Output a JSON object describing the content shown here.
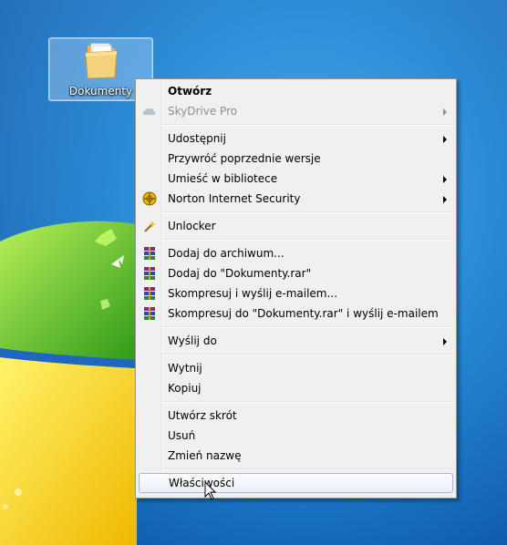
{
  "desktop": {
    "icon": {
      "label": "Dokumenty",
      "icon": "folder-icon"
    }
  },
  "context_menu": {
    "groups": [
      [
        {
          "label": "Otwórz",
          "bold": true
        },
        {
          "label": "SkyDrive Pro",
          "disabled": true,
          "submenu": true,
          "icon": "skydrive-cloud-icon"
        }
      ],
      [
        {
          "label": "Udostępnij",
          "submenu": true
        },
        {
          "label": "Przywróć poprzednie wersje"
        },
        {
          "label": "Umieść w bibliotece",
          "submenu": true
        },
        {
          "label": "Norton Internet Security",
          "submenu": true,
          "icon": "norton-icon"
        }
      ],
      [
        {
          "label": "Unlocker",
          "icon": "unlocker-wand-icon"
        }
      ],
      [
        {
          "label": "Dodaj do archiwum...",
          "icon": "winrar-icon"
        },
        {
          "label": "Dodaj do \"Dokumenty.rar\"",
          "icon": "winrar-icon"
        },
        {
          "label": "Skompresuj i wyślij e-mailem...",
          "icon": "winrar-icon"
        },
        {
          "label": "Skompresuj do \"Dokumenty.rar\" i wyślij e-mailem",
          "icon": "winrar-icon"
        }
      ],
      [
        {
          "label": "Wyślij do",
          "submenu": true
        }
      ],
      [
        {
          "label": "Wytnij"
        },
        {
          "label": "Kopiuj"
        }
      ],
      [
        {
          "label": "Utwórz skrót"
        },
        {
          "label": "Usuń"
        },
        {
          "label": "Zmień nazwę"
        }
      ],
      [
        {
          "label": "Właściwości",
          "highlighted": true
        }
      ]
    ]
  },
  "colors": {
    "desktop_blue": "#1a7fd0",
    "menu_background": "#f0f0f0",
    "highlight_border": "#a8b8d4"
  }
}
